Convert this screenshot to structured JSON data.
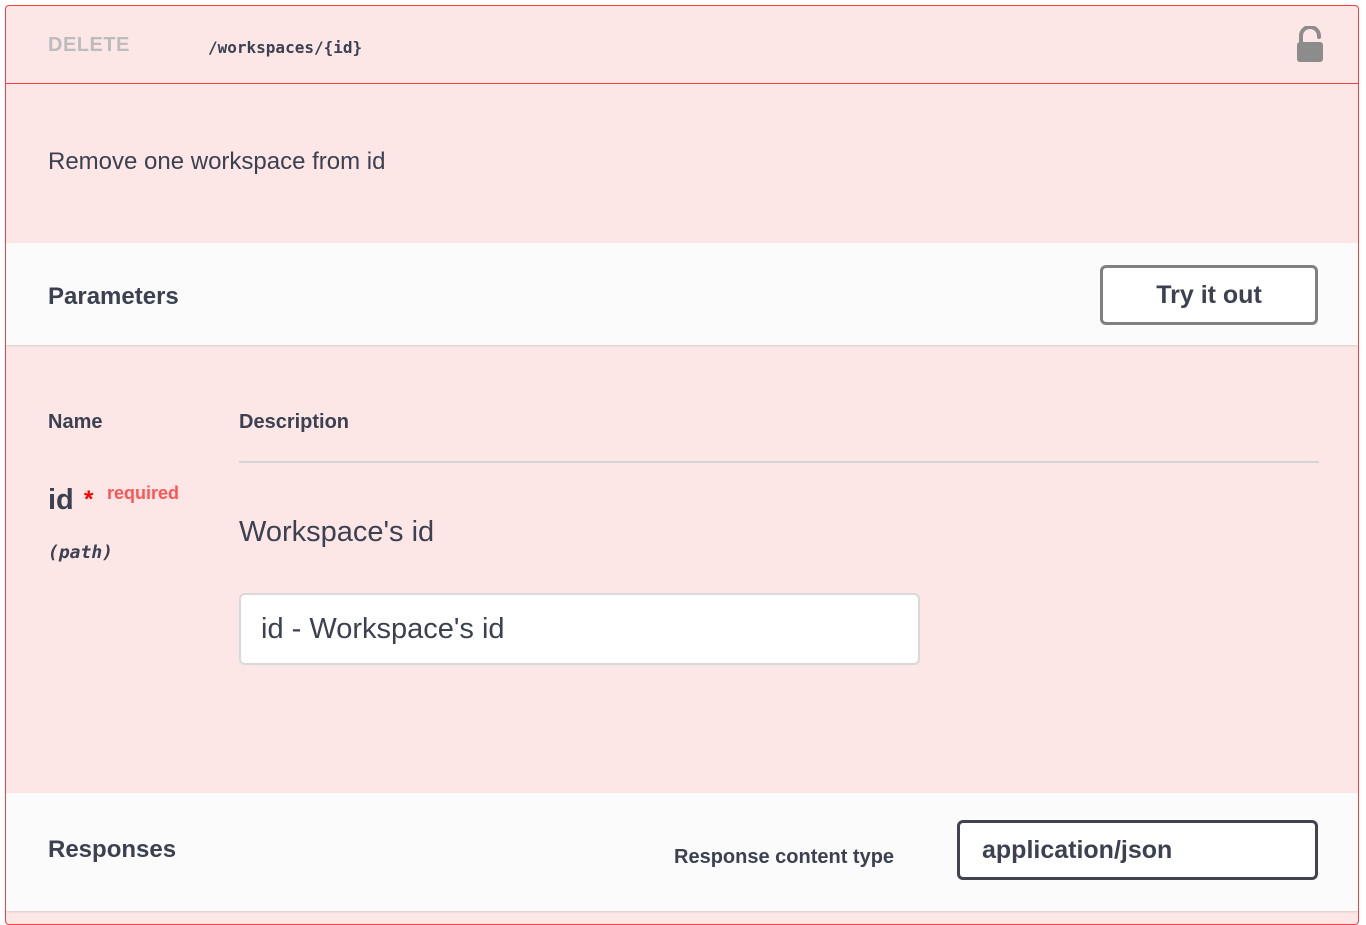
{
  "operation": {
    "method": "DELETE",
    "path": "/workspaces/{id}",
    "description": "Remove one workspace from id",
    "lock_icon": "lock-open-icon"
  },
  "parameters": {
    "title": "Parameters",
    "try_button_label": "Try it out",
    "columns": {
      "name": "Name",
      "description": "Description"
    },
    "items": [
      {
        "name": "id",
        "required_marker": "*",
        "required_label": "required",
        "location": "(path)",
        "description": "Workspace's id",
        "input_placeholder": "id - Workspace's id"
      }
    ]
  },
  "responses": {
    "title": "Responses",
    "content_type_label": "Response content type",
    "content_type_value": "application/json"
  },
  "colors": {
    "accent_delete": "#f93e3e",
    "block_background": "#fce6e6",
    "required": "#ff0000"
  }
}
